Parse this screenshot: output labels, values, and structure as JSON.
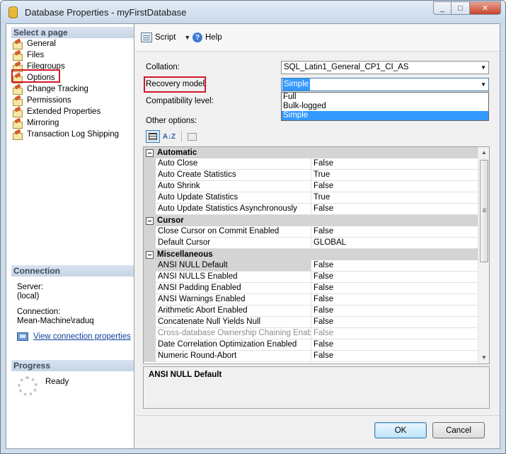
{
  "window": {
    "title": "Database Properties - myFirstDatabase",
    "controls": [
      "_",
      "□",
      "✕"
    ]
  },
  "left_pane": {
    "select_header": "Select a page",
    "pages": [
      {
        "label": "General"
      },
      {
        "label": "Files"
      },
      {
        "label": "Filegroups"
      },
      {
        "label": "Options",
        "selected": true
      },
      {
        "label": "Change Tracking"
      },
      {
        "label": "Permissions"
      },
      {
        "label": "Extended Properties"
      },
      {
        "label": "Mirroring"
      },
      {
        "label": "Transaction Log Shipping"
      }
    ],
    "connection_header": "Connection",
    "server_label": "Server:",
    "server_value": "(local)",
    "connection_label": "Connection:",
    "connection_value": "Mean-Machine\\raduq",
    "view_link": "View connection properties",
    "progress_header": "Progress",
    "progress_status": "Ready"
  },
  "toolbar": {
    "script_label": "Script",
    "help_label": "Help"
  },
  "form": {
    "collation_label": "Collation:",
    "collation_value": "SQL_Latin1_General_CP1_CI_AS",
    "recovery_label": "Recovery model:",
    "recovery_value": "Simple",
    "recovery_options": [
      "Full",
      "Bulk-logged",
      "Simple"
    ],
    "compat_label": "Compatibility level:",
    "other_options_label": "Other options:"
  },
  "property_grid": {
    "categories": [
      {
        "name": "Automatic",
        "rows": [
          {
            "name": "Auto Close",
            "value": "False"
          },
          {
            "name": "Auto Create Statistics",
            "value": "True"
          },
          {
            "name": "Auto Shrink",
            "value": "False"
          },
          {
            "name": "Auto Update Statistics",
            "value": "True"
          },
          {
            "name": "Auto Update Statistics Asynchronously",
            "value": "False"
          }
        ]
      },
      {
        "name": "Cursor",
        "rows": [
          {
            "name": "Close Cursor on Commit Enabled",
            "value": "False"
          },
          {
            "name": "Default Cursor",
            "value": "GLOBAL"
          }
        ]
      },
      {
        "name": "Miscellaneous",
        "rows": [
          {
            "name": "ANSI NULL Default",
            "value": "False",
            "selected": true
          },
          {
            "name": "ANSI NULLS Enabled",
            "value": "False"
          },
          {
            "name": "ANSI Padding Enabled",
            "value": "False"
          },
          {
            "name": "ANSI Warnings Enabled",
            "value": "False"
          },
          {
            "name": "Arithmetic Abort Enabled",
            "value": "False"
          },
          {
            "name": "Concatenate Null Yields Null",
            "value": "False"
          },
          {
            "name": "Cross-database Ownership Chaining Enabled",
            "value": "False",
            "disabled": true
          },
          {
            "name": "Date Correlation Optimization Enabled",
            "value": "False"
          },
          {
            "name": "Numeric Round-Abort",
            "value": "False"
          }
        ]
      }
    ],
    "description_title": "ANSI NULL Default"
  },
  "buttons": {
    "ok": "OK",
    "cancel": "Cancel"
  },
  "colors": {
    "highlight": "#3399ff",
    "annotation_red": "#d0192a"
  }
}
